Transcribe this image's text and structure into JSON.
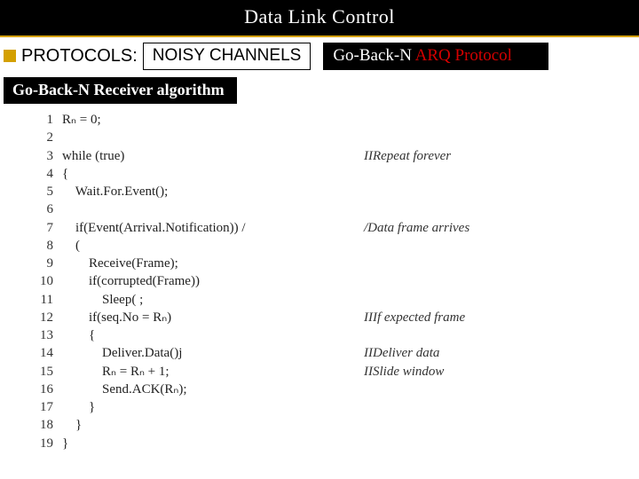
{
  "title": "Data Link Control",
  "row2": {
    "protocols_label": "PROTOCOLS:",
    "noisy": "NOISY CHANNELS",
    "arq_prefix": "Go-Back-N ",
    "arq_red": "ARQ Protocol"
  },
  "subtitle": "Go-Back-N Receiver algorithm",
  "code": [
    {
      "n": "1",
      "t": "Rₙ = 0;",
      "c": ""
    },
    {
      "n": "2",
      "t": "",
      "c": ""
    },
    {
      "n": "3",
      "t": "while (true)",
      "c": "IIRepeat forever"
    },
    {
      "n": "4",
      "t": "{",
      "c": ""
    },
    {
      "n": "5",
      "t": "    Wait.For.Event();",
      "c": ""
    },
    {
      "n": "6",
      "t": "",
      "c": ""
    },
    {
      "n": "7",
      "t": "    if(Event(Arrival.Notification)) /",
      "c": "/Data frame arrives"
    },
    {
      "n": "8",
      "t": "    (",
      "c": ""
    },
    {
      "n": "9",
      "t": "        Receive(Frame);",
      "c": ""
    },
    {
      "n": "10",
      "t": "        if(corrupted(Frame))",
      "c": ""
    },
    {
      "n": "11",
      "t": "            Sleep( ;",
      "c": ""
    },
    {
      "n": "12",
      "t": "        if(seq.No = Rₙ)",
      "c": "IIIf expected frame"
    },
    {
      "n": "13",
      "t": "        {",
      "c": ""
    },
    {
      "n": "14",
      "t": "            Deliver.Data()j",
      "c": "IIDeliver data"
    },
    {
      "n": "15",
      "t": "            Rₙ = Rₙ + 1;",
      "c": "IISlide window"
    },
    {
      "n": "16",
      "t": "            Send.ACK(Rₙ);",
      "c": ""
    },
    {
      "n": "17",
      "t": "        }",
      "c": ""
    },
    {
      "n": "18",
      "t": "    }",
      "c": ""
    },
    {
      "n": "19",
      "t": "}",
      "c": ""
    }
  ]
}
